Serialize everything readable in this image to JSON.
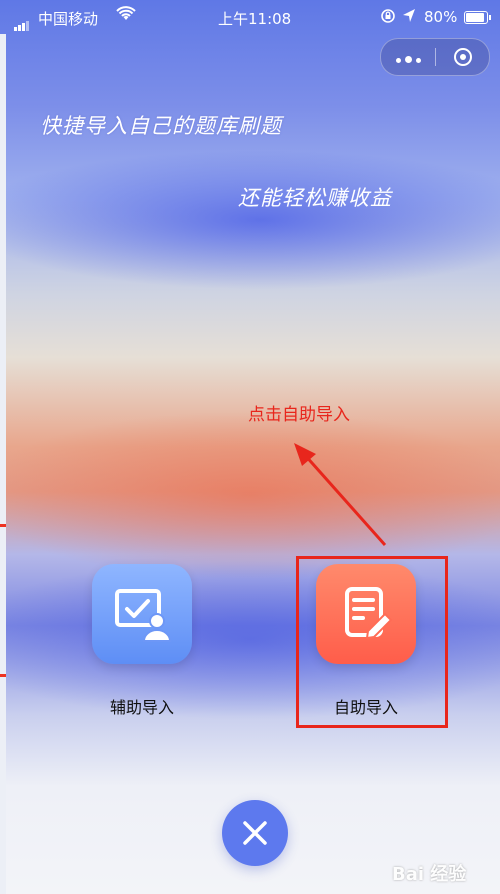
{
  "status_bar": {
    "carrier": "中国移动",
    "time": "上午11:08",
    "battery": "80%",
    "battery_level": 0.8
  },
  "capsule": {
    "more_icon": "more-dots-icon",
    "close_icon": "target-close-icon"
  },
  "hero": {
    "line1": "快捷导入自己的题库刷题",
    "line2": "还能轻松赚收益"
  },
  "annotation": {
    "text": "点击自助导入",
    "color": "#e8261c"
  },
  "options": {
    "assist": {
      "label": "辅助导入",
      "icon": "monitor-check-user-icon"
    },
    "self": {
      "label": "自助导入",
      "icon": "document-edit-icon"
    }
  },
  "close_button": {
    "icon": "close-x-icon",
    "color": "#5d79ee"
  },
  "watermark": {
    "text": "Bai 经验"
  }
}
